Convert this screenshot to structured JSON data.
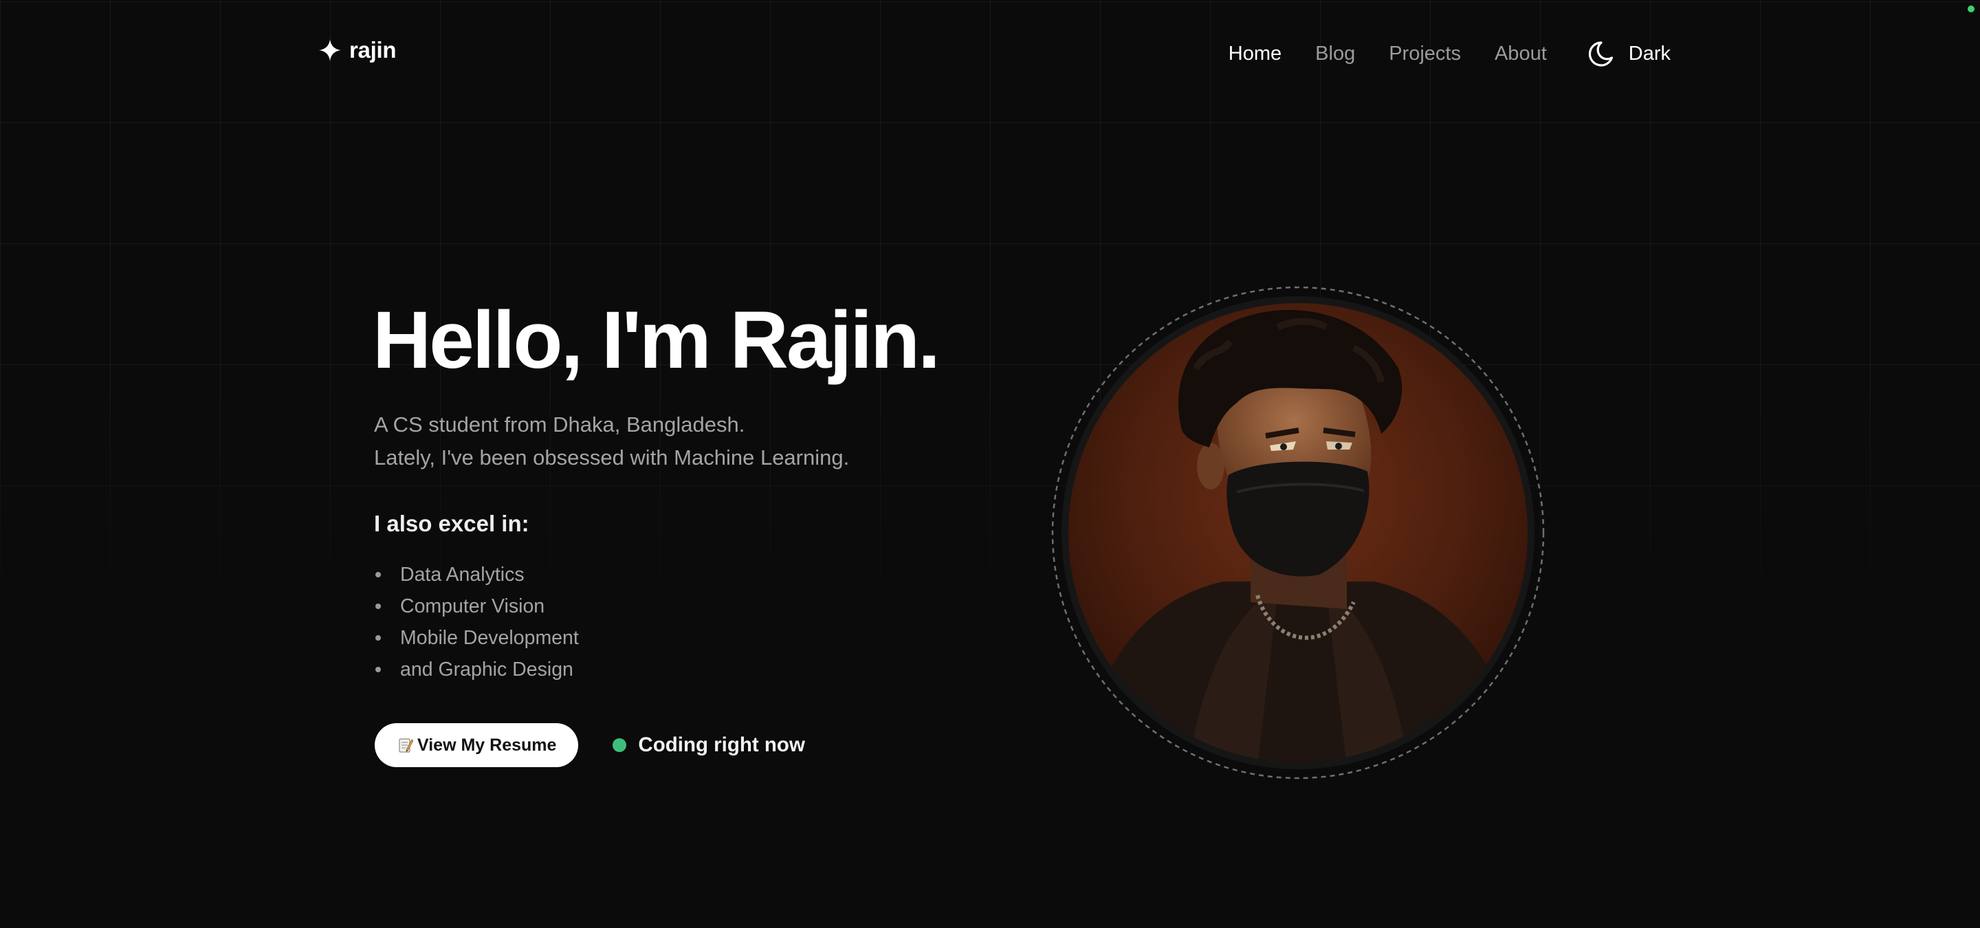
{
  "header": {
    "brand": "rajin",
    "brand_icon": "sparkle-icon",
    "nav": [
      {
        "label": "Home",
        "active": true
      },
      {
        "label": "Blog",
        "active": false
      },
      {
        "label": "Projects",
        "active": false
      },
      {
        "label": "About",
        "active": false
      }
    ],
    "theme_toggle": {
      "label": "Dark",
      "icon": "moon-icon"
    }
  },
  "hero": {
    "title": "Hello, I'm Rajin.",
    "intro": [
      "A CS student from Dhaka, Bangladesh.",
      "Lately, I've been obsessed with Machine Learning."
    ],
    "skills_heading": "I also excel in:",
    "skills": [
      "Data Analytics",
      "Computer Vision",
      "Mobile Development",
      "and Graphic Design"
    ],
    "resume_button": {
      "icon": "memo-icon",
      "label": "View My Resume"
    },
    "status": {
      "text": "Coding right now",
      "color": "#3dbf7b"
    },
    "avatar": {
      "icon": "pixel-art-portrait"
    }
  },
  "colors": {
    "background": "#0b0b0b",
    "muted_text": "#a4a4a4",
    "nav_inactive": "#9b9b9b",
    "status_green": "#3dbf7b",
    "avatar_background": "#5a2512"
  }
}
